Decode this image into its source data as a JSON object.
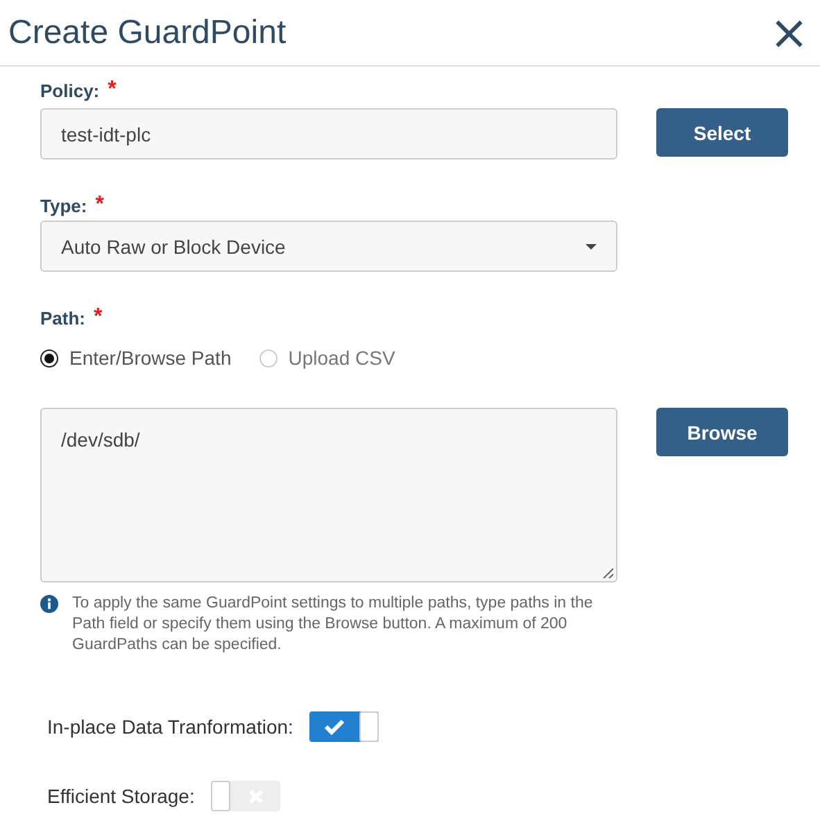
{
  "dialog": {
    "title": "Create GuardPoint",
    "close": "×"
  },
  "policy": {
    "label": "Policy:",
    "required_mark": "*",
    "value": "test-idt-plc",
    "button": "Select"
  },
  "type": {
    "label": "Type:",
    "required_mark": "*",
    "value": "Auto Raw or Block Device"
  },
  "path": {
    "label": "Path:",
    "required_mark": "*",
    "options": [
      {
        "label": "Enter/Browse Path",
        "selected": true
      },
      {
        "label": "Upload CSV",
        "selected": false
      }
    ],
    "value": "/dev/sdb/",
    "button": "Browse",
    "info": "To apply the same GuardPoint settings to multiple paths, type paths in the Path field or specify them using the Browse button. A maximum of 200 GuardPaths can be specified."
  },
  "toggles": [
    {
      "label": "In-place Data Tranformation:",
      "on": true
    },
    {
      "label": "Efficient Storage:",
      "on": false
    }
  ]
}
